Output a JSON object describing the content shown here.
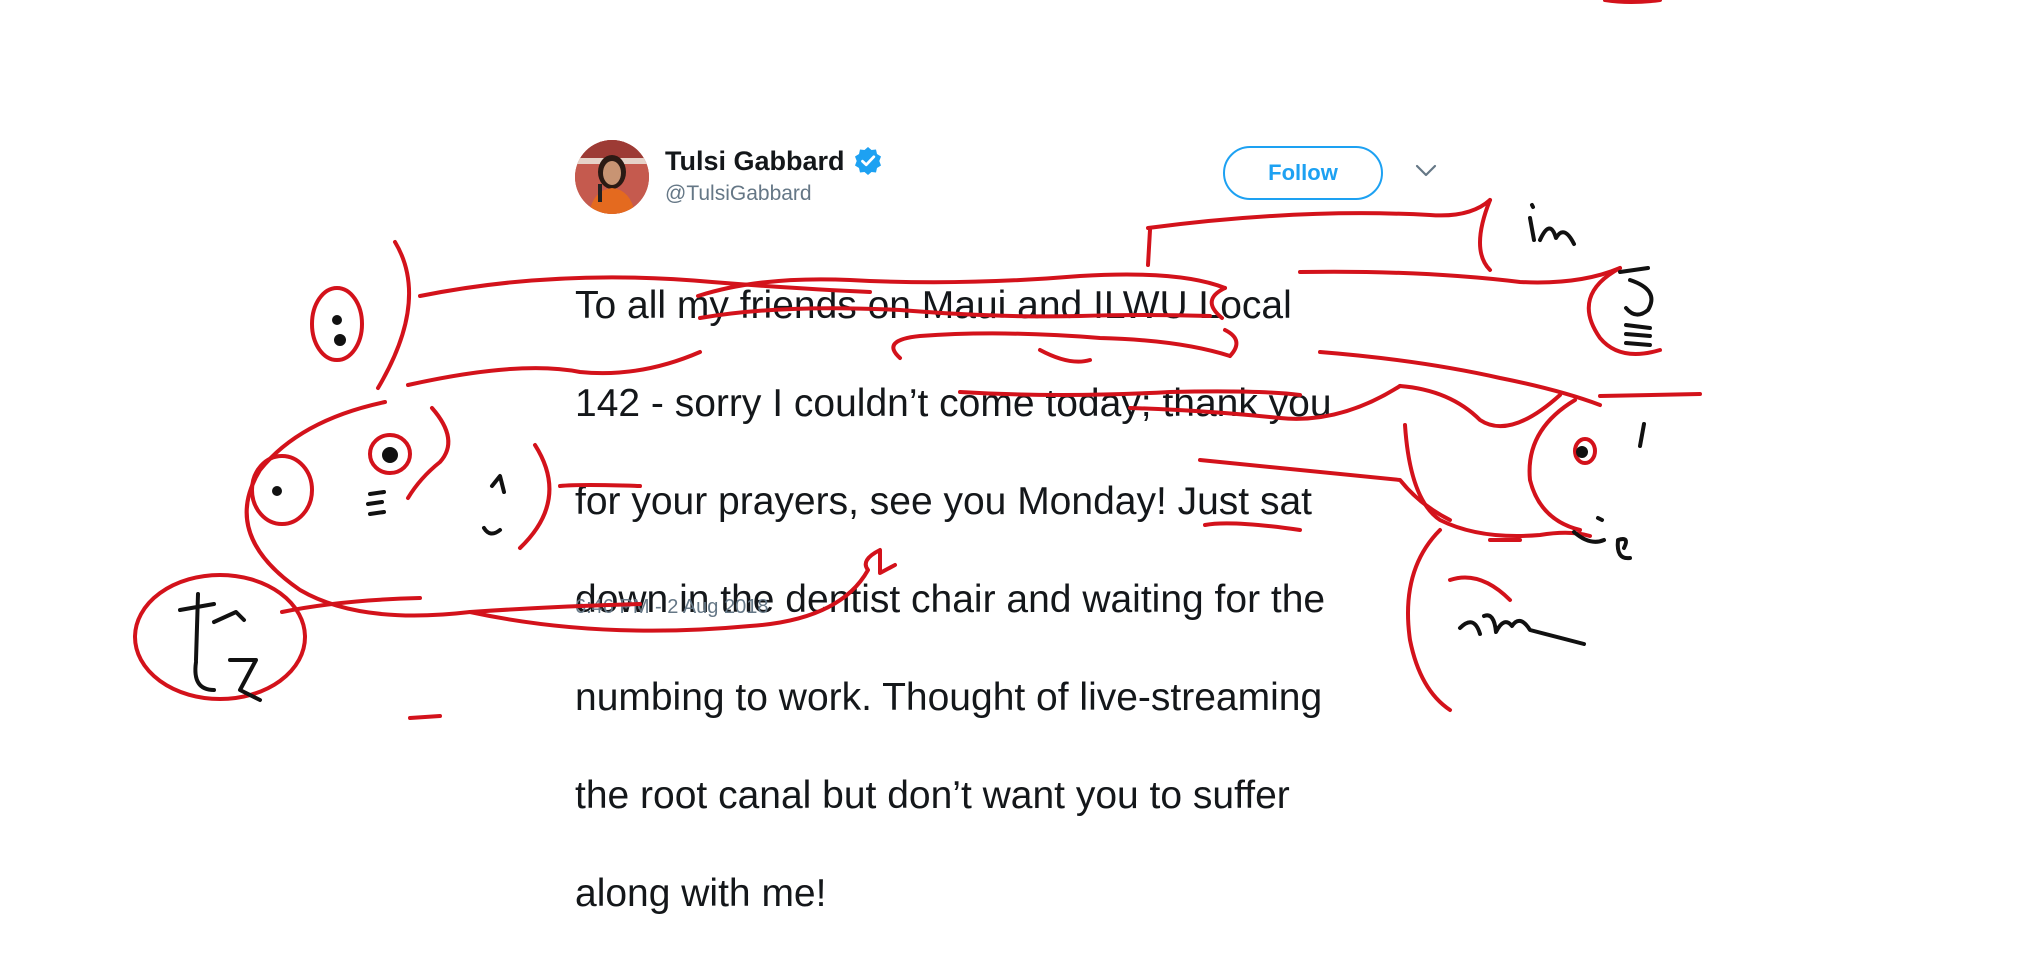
{
  "tweet": {
    "display_name": "Tulsi Gabbard",
    "handle": "@TulsiGabbard",
    "follow_label": "Follow",
    "text_lines": [
      "To all my friends on Maui and ILWU Local",
      "142 - sorry I couldn’t come today; thank you",
      "for your prayers, see you Monday! Just sat",
      "down in the dentist chair and waiting for the",
      "numbing to work. Thought of live-streaming",
      "the root canal but don’t want you to suffer",
      "along with me!"
    ],
    "timestamp": "6:46 PM - 2 Aug 2018",
    "verified_icon": "verified-badge-icon",
    "menu_icon": "chevron-down-icon"
  },
  "colors": {
    "accent": "#1da1f2",
    "annotation_ink": "#d3121b",
    "handwriting_ink": "#111111",
    "text": "#14171a",
    "muted": "#657786"
  }
}
